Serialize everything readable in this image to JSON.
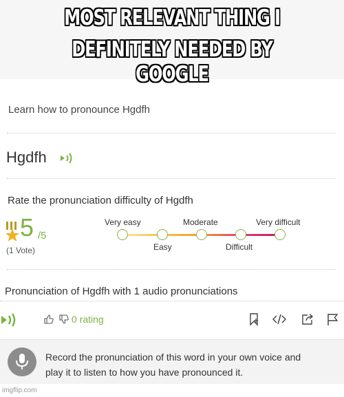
{
  "meme": {
    "caption_line1": "MOST RELEVANT THING I",
    "caption_line2": "DEFINITELY NEEDED BY GOOGLE"
  },
  "page": {
    "learn_heading": "Learn how to pronounce Hgdfh",
    "word": "Hgdfh",
    "rate_heading": "Rate the pronunciation difficulty of Hgdfh",
    "score": "5",
    "score_denominator": "/5",
    "votes": "(1 Vote)",
    "scale_labels": {
      "very_easy": "Very easy",
      "easy": "Easy",
      "moderate": "Moderate",
      "difficult": "Difficult",
      "very_difficult": "Very difficult"
    },
    "pronunciation_heading": "Pronunciation of Hgdfh with 1 audio pronunciations",
    "rating_text": "0 rating",
    "record_line1": "Record the pronunciation of this word in your own voice and",
    "record_line2": "play it to listen to how you have pronounced it."
  },
  "colors": {
    "accent_green": "#7cb342",
    "scale_gradient": [
      "#f6dc6a",
      "#f3a33a",
      "#e6386b",
      "#c31a6a"
    ]
  },
  "icons": [
    "speaker-icon",
    "star-trophy-icon",
    "thumbs-up-icon",
    "thumbs-down-icon",
    "bookmark-icon",
    "embed-code-icon",
    "share-icon",
    "flag-icon",
    "microphone-icon"
  ],
  "watermark": "imgflip.com"
}
